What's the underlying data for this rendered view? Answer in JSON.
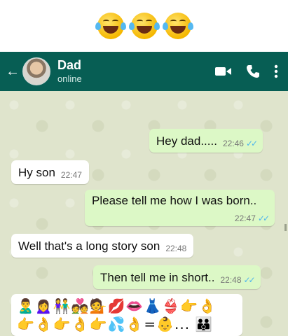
{
  "top_emojis": [
    "face-with-tears-of-joy",
    "face-with-tears-of-joy",
    "face-with-tears-of-joy"
  ],
  "header": {
    "back_icon": "←",
    "contact_name": "Dad",
    "status": "online",
    "icons": [
      "video-call-icon",
      "phone-call-icon",
      "more-options-icon"
    ],
    "color": "#075e54"
  },
  "messages": [
    {
      "side": "out",
      "text": "Hey dad.....",
      "time": "22:46",
      "ticks": "✓✓"
    },
    {
      "side": "in",
      "text": "Hy son",
      "time": "22:47"
    },
    {
      "side": "out",
      "text": "Please tell me how I was born..",
      "time": "22:47",
      "ticks": "✓✓"
    },
    {
      "side": "in",
      "text": "Well that's a long story son",
      "time": "22:48"
    },
    {
      "side": "out",
      "text": "Then tell me in short..",
      "time": "22:48",
      "ticks": "✓✓"
    },
    {
      "side": "in",
      "text": "🙎‍♂️🙍‍♀️👫💑💁💋👄👗👙👉👌 👉👌👉👌👉💦👌=👶... 👪"
    }
  ],
  "colors": {
    "outgoing_bubble": "#dcf8c6",
    "incoming_bubble": "#ffffff",
    "read_ticks": "#4fb6ec"
  }
}
